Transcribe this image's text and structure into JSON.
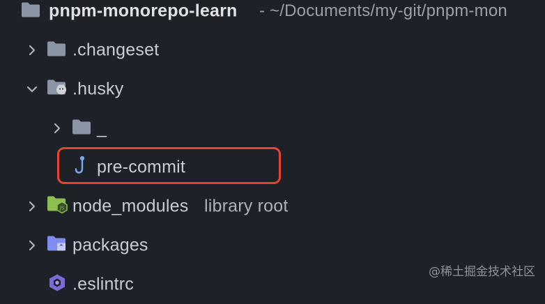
{
  "project": {
    "name": "pnpm-monorepo-learn",
    "path": " - ~/Documents/my-git/pnpm-mon"
  },
  "items": [
    {
      "label": ".changeset",
      "icon": "folder-icon"
    },
    {
      "label": ".husky",
      "icon": "husky-folder-icon"
    },
    {
      "label": "_",
      "icon": "folder-icon"
    },
    {
      "label": "pre-commit",
      "icon": "hook-icon"
    },
    {
      "label": "node_modules",
      "extra": "library root",
      "icon": "node-modules-folder-icon"
    },
    {
      "label": "packages",
      "icon": "package-folder-icon"
    },
    {
      "label": ".eslintrc",
      "icon": "eslint-icon"
    }
  ],
  "highlight_color": "#e5452e",
  "watermark": "@稀土掘金技术社区"
}
